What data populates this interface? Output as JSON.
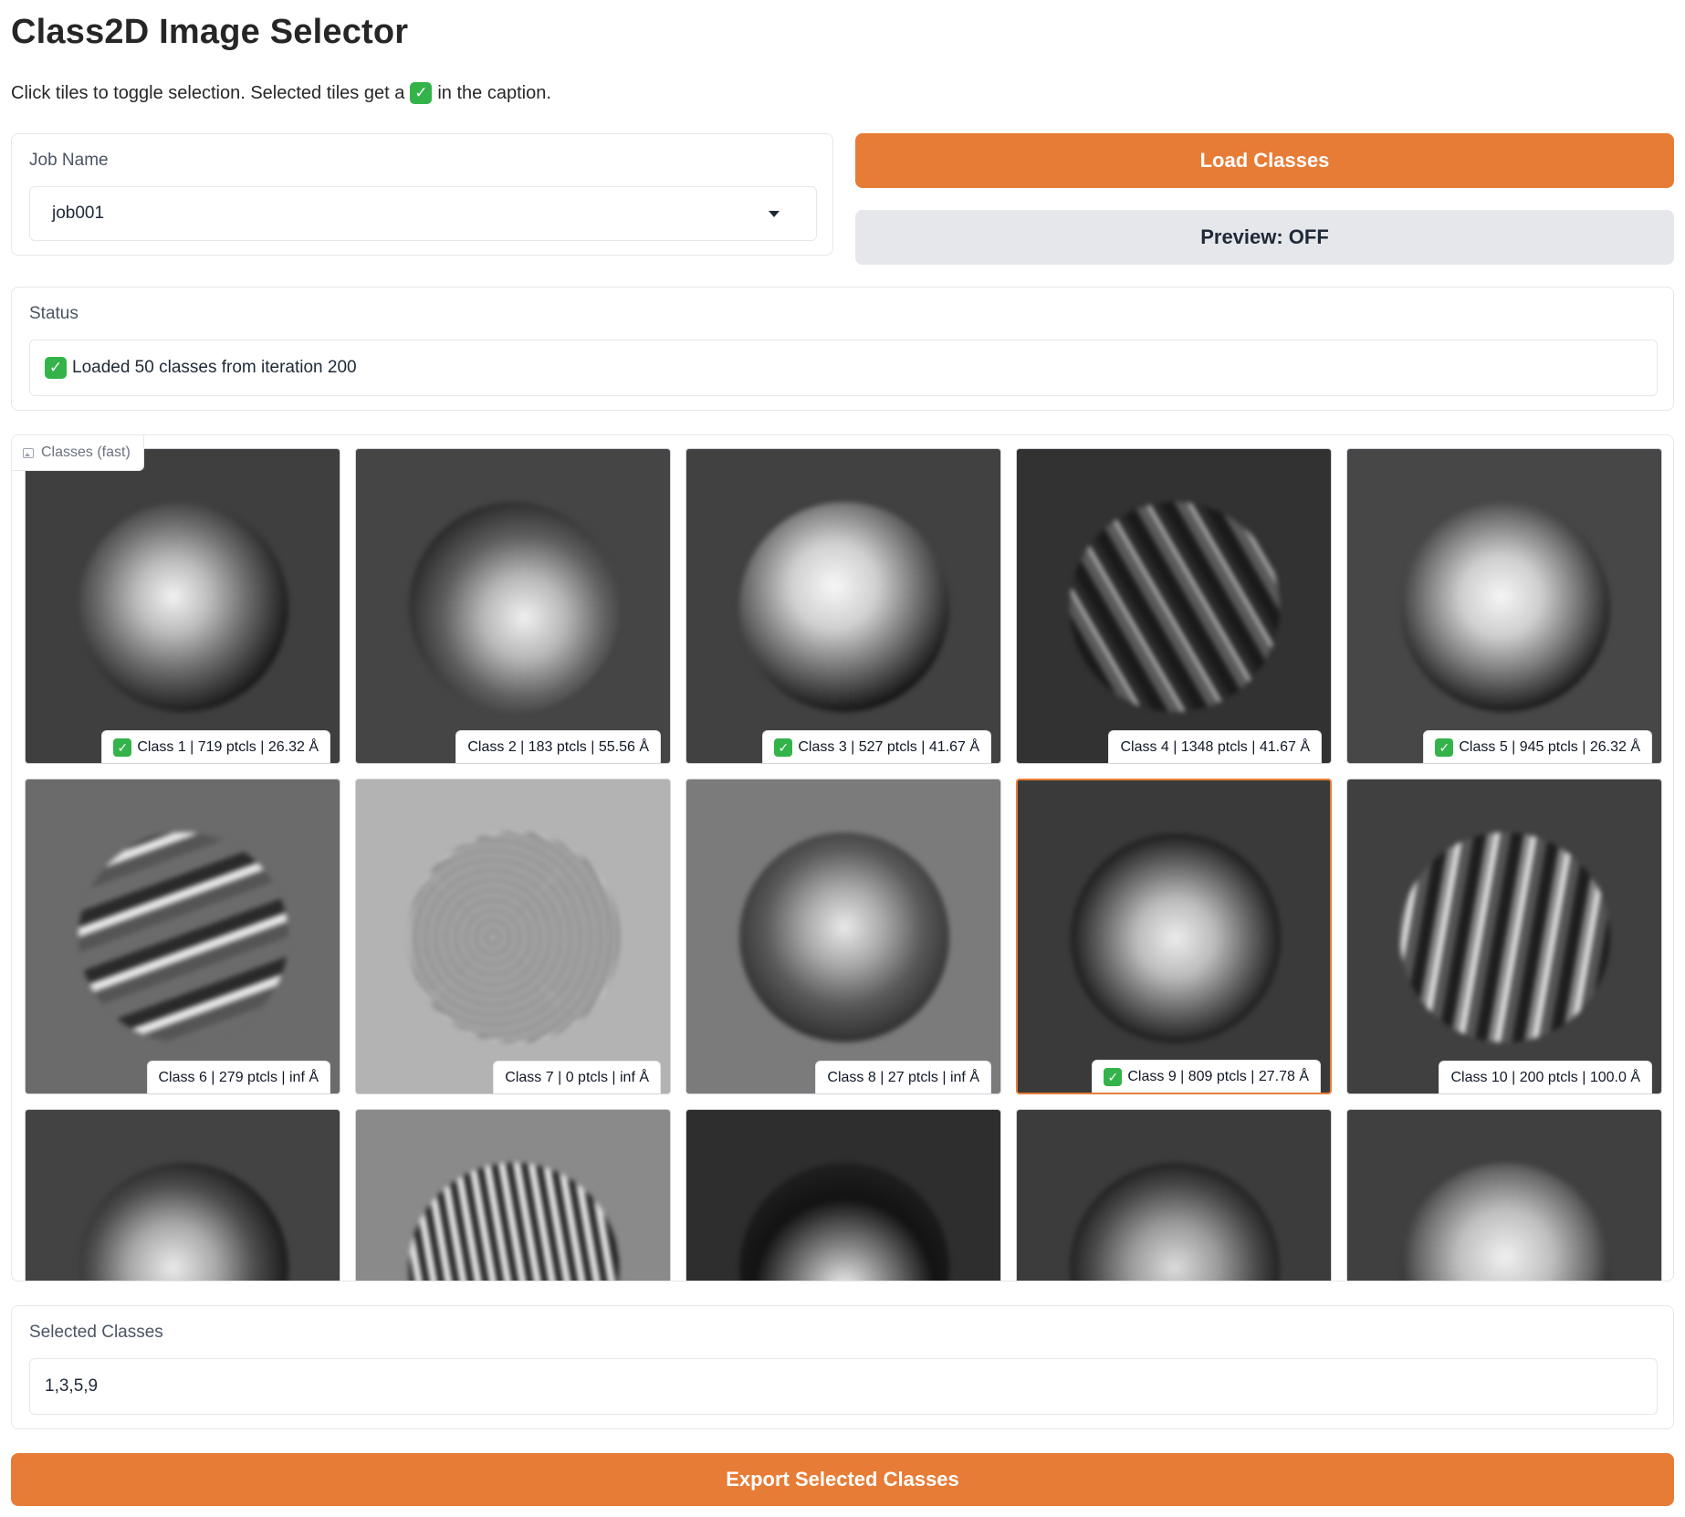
{
  "header": {
    "title": "Class2D Image Selector",
    "subtitle_before": "Click tiles to toggle selection. Selected tiles get a",
    "subtitle_after": "in the caption."
  },
  "job": {
    "label": "Job Name",
    "value": "job001"
  },
  "buttons": {
    "load": "Load Classes",
    "preview": "Preview: OFF",
    "export": "Export Selected Classes"
  },
  "status": {
    "label": "Status",
    "message": "Loaded 50 classes from iteration 200"
  },
  "gallery": {
    "label": "Classes (fast)",
    "tiles": [
      {
        "caption": "Class 1 | 719 ptcls | 26.32 Å",
        "selected": true
      },
      {
        "caption": "Class 2 | 183 ptcls | 55.56 Å",
        "selected": false
      },
      {
        "caption": "Class 3 | 527 ptcls | 41.67 Å",
        "selected": true
      },
      {
        "caption": "Class 4 | 1348 ptcls | 41.67 Å",
        "selected": false
      },
      {
        "caption": "Class 5 | 945 ptcls | 26.32 Å",
        "selected": true
      },
      {
        "caption": "Class 6 | 279 ptcls | inf Å",
        "selected": false
      },
      {
        "caption": "Class 7 | 0 ptcls | inf Å",
        "selected": false
      },
      {
        "caption": "Class 8 | 27 ptcls | inf Å",
        "selected": false
      },
      {
        "caption": "Class 9 | 809 ptcls | 27.78 Å",
        "selected": true
      },
      {
        "caption": "Class 10 | 200 ptcls | 100.0 Å",
        "selected": false
      }
    ]
  },
  "selected_classes": {
    "label": "Selected Classes",
    "value": "1,3,5,9"
  },
  "colors": {
    "accent": "#e77c36",
    "check": "#34b34a"
  }
}
